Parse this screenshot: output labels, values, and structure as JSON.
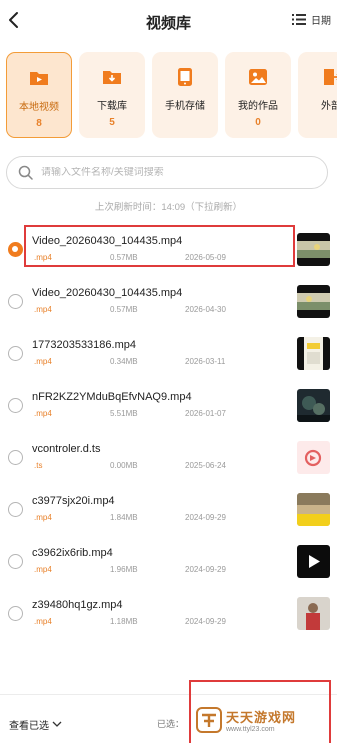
{
  "header": {
    "title": "视频库",
    "date_label": "日期"
  },
  "categories": [
    {
      "label": "本地视频",
      "count": "8",
      "icon": "folder-video-icon",
      "active": true
    },
    {
      "label": "下载库",
      "count": "5",
      "icon": "folder-download-icon",
      "active": false
    },
    {
      "label": "手机存储",
      "count": "",
      "icon": "phone-icon",
      "active": false
    },
    {
      "label": "我的作品",
      "count": "0",
      "icon": "image-icon",
      "active": false
    },
    {
      "label": "外部",
      "count": "",
      "icon": "external-icon",
      "active": false
    }
  ],
  "search": {
    "placeholder": "请输入文件名称/关键词搜索",
    "value": ""
  },
  "refresh_hint": "上次刷新时间：14:09（下拉刷新）",
  "files": [
    {
      "name": "Video_20260430_104435.mp4",
      "ext": ".mp4",
      "size": "0.57MB",
      "date": "2026-05-09",
      "checked": true,
      "thumb": "landscape"
    },
    {
      "name": "Video_20260430_104435.mp4",
      "ext": ".mp4",
      "size": "0.57MB",
      "date": "2026-04-30",
      "checked": false,
      "thumb": "landscape"
    },
    {
      "name": "1773203533186.mp4",
      "ext": ".mp4",
      "size": "0.34MB",
      "date": "2026-03-11",
      "checked": false,
      "thumb": "portrait-yellow"
    },
    {
      "name": "nFR2KZ2YMduBqEfvNAQ9.mp4",
      "ext": ".mp4",
      "size": "5.51MB",
      "date": "2026-01-07",
      "checked": false,
      "thumb": "dark-scene"
    },
    {
      "name": "vcontroler.d.ts",
      "ext": ".ts",
      "size": "0.00MB",
      "date": "2025-06-24",
      "checked": false,
      "thumb": "ts-file"
    },
    {
      "name": "c3977sjx20i.mp4",
      "ext": ".mp4",
      "size": "1.84MB",
      "date": "2024-09-29",
      "checked": false,
      "thumb": "yellow-band"
    },
    {
      "name": "c3962ix6rib.mp4",
      "ext": ".mp4",
      "size": "1.96MB",
      "date": "2024-09-29",
      "checked": false,
      "thumb": "play-black"
    },
    {
      "name": "z39480hq1gz.mp4",
      "ext": ".mp4",
      "size": "1.18MB",
      "date": "2024-09-29",
      "checked": false,
      "thumb": "red-person"
    }
  ],
  "bottom": {
    "view_selected": "查看已选",
    "selected_label": "已选："
  },
  "watermark": {
    "title": "天天游戏网",
    "url": "www.ttyl23.com"
  },
  "colors": {
    "accent": "#f07c1e",
    "highlight": "#df3b3b",
    "card_bg": "#fdf1e6"
  }
}
